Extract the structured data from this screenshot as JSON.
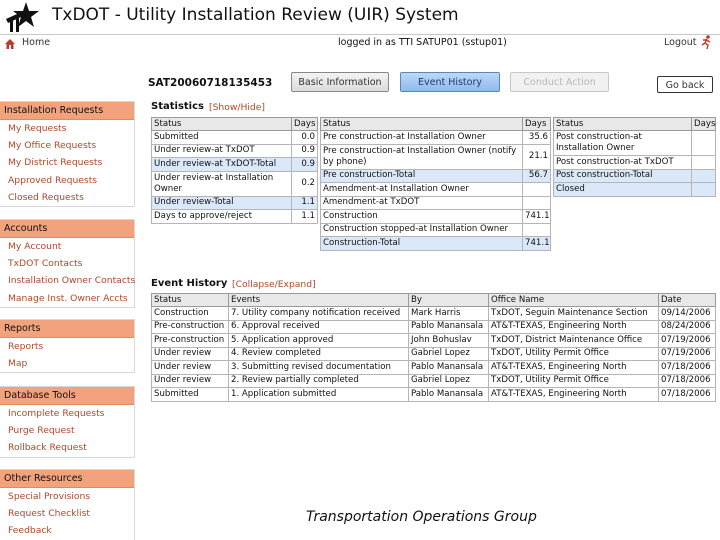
{
  "app": {
    "title": "TxDOT - Utility Installation Review (UIR) System"
  },
  "nav": {
    "home": "Home",
    "logged_in": "logged in as TTI SATUP01 (sstup01)",
    "logout": "Logout"
  },
  "request": {
    "id": "SAT20060718135453"
  },
  "buttons": {
    "basic": "Basic Information",
    "event": "Event History",
    "conduct": "Conduct Action",
    "goback": "Go back"
  },
  "sidebar": [
    {
      "title": "Installation Requests",
      "items": [
        "My Requests",
        "My Office Requests",
        "My District Requests",
        "Approved Requests",
        "Closed Requests"
      ]
    },
    {
      "title": "Accounts",
      "items": [
        "My Account",
        "TxDOT Contacts",
        "Installation Owner Contacts",
        "Manage Inst. Owner Accts"
      ]
    },
    {
      "title": "Reports",
      "items": [
        "Reports",
        "Map"
      ]
    },
    {
      "title": "Database Tools",
      "items": [
        "Incomplete Requests",
        "Purge Request",
        "Rollback Request"
      ]
    },
    {
      "title": "Other Resources",
      "items": [
        "Special Provisions",
        "Request Checklist",
        "Feedback"
      ]
    }
  ],
  "statistics": {
    "title": "Statistics",
    "toggle": "[Show/Hide]",
    "headers": {
      "status": "Status",
      "days": "Days"
    },
    "table1": [
      {
        "status": "Submitted",
        "days": "0.0"
      },
      {
        "status": "Under review-at TxDOT",
        "days": "0.9"
      },
      {
        "status": "Under review-at TxDOT-Total",
        "days": "0.9"
      },
      {
        "status": "Under review-at Installation Owner",
        "days": "0.2"
      },
      {
        "status": "Under review-Total",
        "days": "1.1"
      },
      {
        "status": "Days to approve/reject",
        "days": "1.1"
      }
    ],
    "table2": [
      {
        "status": "Pre construction-at Installation Owner",
        "days": "35.6"
      },
      {
        "status": "Pre construction-at Installation Owner (notify by phone)",
        "days": "21.1"
      },
      {
        "status": "Pre construction-Total",
        "days": "56.7"
      },
      {
        "status": "Amendment-at Installation Owner",
        "days": ""
      },
      {
        "status": "Amendment-at TxDOT",
        "days": ""
      },
      {
        "status": "Construction",
        "days": "741.1"
      },
      {
        "status": "Construction stopped-at Installation Owner",
        "days": ""
      },
      {
        "status": "Construction-Total",
        "days": "741.1"
      }
    ],
    "table3": [
      {
        "status": "Post construction-at Installation Owner",
        "days": ""
      },
      {
        "status": "Post construction-at TxDOT",
        "days": ""
      },
      {
        "status": "Post construction-Total",
        "days": ""
      },
      {
        "status": "Closed",
        "days": ""
      }
    ]
  },
  "event_history": {
    "title": "Event History",
    "toggle": "[Collapse/Expand]",
    "headers": {
      "status": "Status",
      "events": "Events",
      "by": "By",
      "office": "Office Name",
      "date": "Date"
    },
    "rows": [
      {
        "status": "Construction",
        "event": "7. Utility company notification received",
        "by": "Mark Harris",
        "office": "TxDOT, Seguin Maintenance Section",
        "date": "09/14/2006"
      },
      {
        "status": "Pre-construction",
        "event": "6. Approval received",
        "by": "Pablo Manansala",
        "office": "AT&T-TEXAS, Engineering North",
        "date": "08/24/2006"
      },
      {
        "status": "Pre-construction",
        "event": "5. Application approved",
        "by": "John Bohuslav",
        "office": "TxDOT, District Maintenance Office",
        "date": "07/19/2006"
      },
      {
        "status": "Under review",
        "event": "4. Review completed",
        "by": "Gabriel Lopez",
        "office": "TxDOT, Utility Permit Office",
        "date": "07/19/2006"
      },
      {
        "status": "Under review",
        "event": "3. Submitting revised documentation",
        "by": "Pablo Manansala",
        "office": "AT&T-TEXAS, Engineering North",
        "date": "07/18/2006"
      },
      {
        "status": "Under review",
        "event": "2. Review partially completed",
        "by": "Gabriel Lopez",
        "office": "TxDOT, Utility Permit Office",
        "date": "07/18/2006"
      },
      {
        "status": "Submitted",
        "event": "1. Application submitted",
        "by": "Pablo Manansala",
        "office": "AT&T-TEXAS, Engineering North",
        "date": "07/18/2006"
      }
    ]
  },
  "footer": {
    "text": "Transportation Operations Group"
  }
}
